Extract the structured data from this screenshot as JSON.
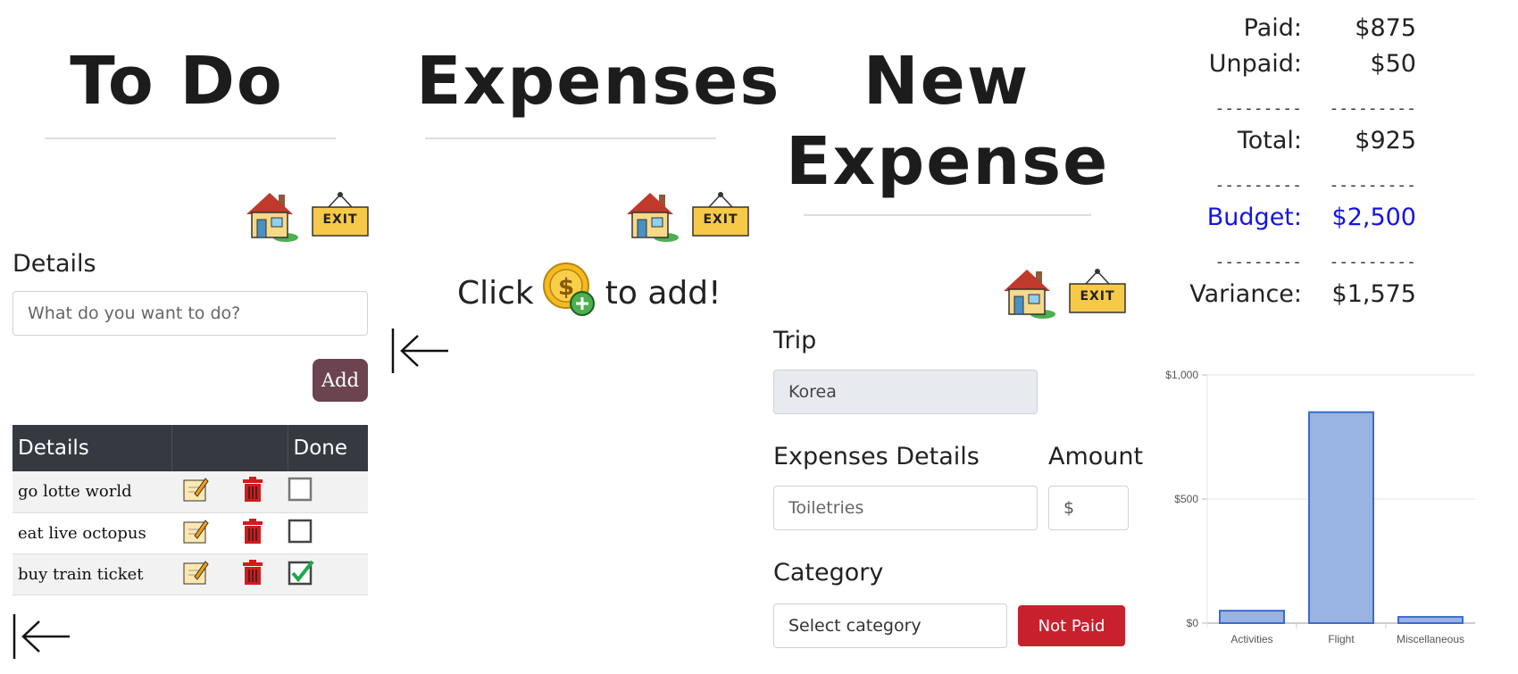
{
  "todo": {
    "title": "To Do",
    "details_label": "Details",
    "input_placeholder": "What do you want to do?",
    "add_label": "Add",
    "table": {
      "headers": [
        "Details",
        "",
        "Done"
      ],
      "rows": [
        {
          "text": "go lotte world",
          "done": false
        },
        {
          "text": "eat live octopus",
          "done": false
        },
        {
          "text": "buy train ticket",
          "done": true
        }
      ]
    }
  },
  "expenses": {
    "title": "Expenses",
    "click_text": "Click",
    "to_add_text": "to add!"
  },
  "new_expense": {
    "title_line1": "New",
    "title_line2": "Expense",
    "trip_label": "Trip",
    "trip_value": "Korea",
    "details_label": "Expenses Details",
    "details_placeholder": "Toiletries",
    "amount_label": "Amount",
    "amount_placeholder": "$",
    "category_label": "Category",
    "category_selected": "Select category",
    "status_button": "Not Paid"
  },
  "nav": {
    "home_icon": "house-icon",
    "exit_label": "EXIT",
    "back_icon": "back-arrow-icon"
  },
  "summary": {
    "paid_label": "Paid:",
    "paid_value": "$875",
    "unpaid_label": "Unpaid:",
    "unpaid_value": "$50",
    "divider": "---------",
    "total_label": "Total:",
    "total_value": "$925",
    "budget_label": "Budget:",
    "budget_value": "$2,500",
    "variance_label": "Variance:",
    "variance_value": "$1,575",
    "budget_color": "#1414e6"
  },
  "chart_data": {
    "type": "bar",
    "categories": [
      "Activities",
      "Flight",
      "Miscellaneous"
    ],
    "values": [
      50,
      850,
      25
    ],
    "ylim": [
      0,
      1000
    ],
    "yticks": [
      "$0",
      "$500",
      "$1,000"
    ],
    "ytick_values": [
      0,
      500,
      1000
    ],
    "grid": true,
    "bar_color": "#99b3e2",
    "bar_edge": "#3d6bcc"
  }
}
